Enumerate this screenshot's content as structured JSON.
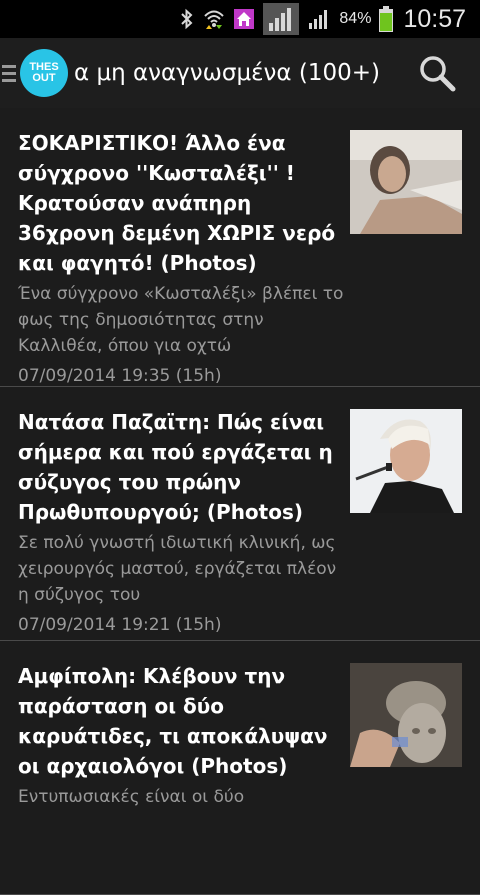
{
  "status_bar": {
    "battery_percent": "84%",
    "time": "10:57",
    "icons": [
      "bluetooth-icon",
      "wifi-icon",
      "home-icon",
      "signal-icon",
      "signal-icon",
      "battery-icon"
    ],
    "battery_color": "#6fc41e"
  },
  "action_bar": {
    "logo_line1": "THES",
    "logo_line2": "OUT",
    "logo_color": "#29c4e6",
    "title": "α μη αναγνωσμένα (100+)"
  },
  "articles": [
    {
      "headline": "ΣΟΚΑΡΙΣΤΙΚΟ! Άλλο ένα σύγχρονο ''Κωσταλέξι'' ! Κρατούσαν ανάπηρη 36χρονη δεμένη ΧΩΡΙΣ νερό και φαγητό! (Photos)",
      "snippet": "Ένα σύγχρονο «Κωσταλέξι» βλέπει το φως της δημοσιότητας στην Καλλιθέα, όπου για οχτώ",
      "timestamp": "07/09/2014 19:35 (15h)"
    },
    {
      "headline": "Νατάσα Παζαϊτη: Πώς είναι σήμερα και πού εργάζεται η σύζυγος του πρώην Πρωθυπουργού; (Photos)",
      "snippet": "Σε πολύ γνωστή ιδιωτική κλινική, ως χειρουργός μαστού, εργάζεται πλέον η σύζυγος του",
      "timestamp": "07/09/2014 19:21 (15h)"
    },
    {
      "headline": "Αμφίπολη: Κλέβουν την παράσταση οι δύο καρυάτιδες, τι αποκάλυψαν οι αρχαιολόγοι (Photos)",
      "snippet": "Εντυπωσιακές είναι οι δύο",
      "timestamp": ""
    }
  ]
}
